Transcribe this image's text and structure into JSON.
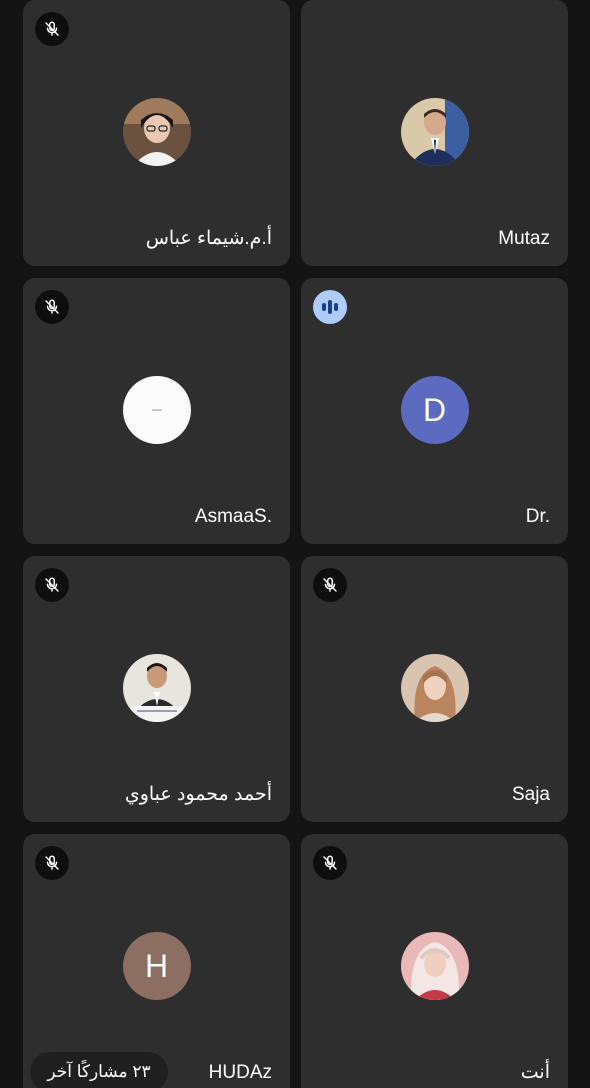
{
  "participants": [
    {
      "name": "أ.م.شيماء عباس",
      "status_icon": "mic-off-icon",
      "avatar": "photo-woman-glasses"
    },
    {
      "name": "Mutaz",
      "status_icon": "none",
      "avatar": "photo-man-suit"
    },
    {
      "name": "AsmaaS.",
      "status_icon": "mic-off-icon",
      "avatar": "photo-white"
    },
    {
      "name": "Dr.",
      "status_icon": "speaking-icon",
      "avatar_letter": "D",
      "avatar_color": "#5c6bc0"
    },
    {
      "name": "أحمد محمود عباوي",
      "status_icon": "mic-off-icon",
      "avatar": "photo-man-desk"
    },
    {
      "name": "Saja",
      "status_icon": "mic-off-icon",
      "avatar": "photo-woman-hair"
    },
    {
      "name": "HUDAz",
      "status_icon": "mic-off-icon",
      "avatar_letter": "H",
      "avatar_color": "#8d6e63"
    },
    {
      "name": "أنت",
      "status_icon": "mic-off-icon",
      "avatar": "photo-woman-hijab"
    }
  ],
  "others_pill": {
    "label": "٢٣ مشاركًا آخر"
  },
  "colors": {
    "background": "#141414",
    "tile": "#2e2e2e",
    "speaking_badge": "#aecbfa"
  }
}
